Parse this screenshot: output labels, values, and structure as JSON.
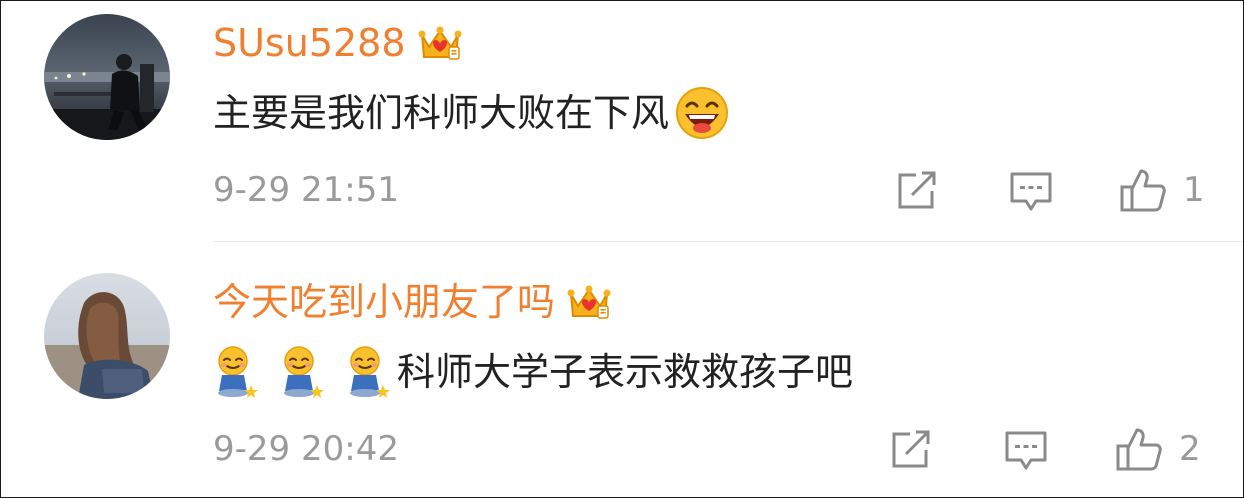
{
  "comments": [
    {
      "username": "SUsu5288",
      "badge_icon": "crown-badge-icon",
      "text": "主要是我们科师大败在下风",
      "emoji": "laughing-emoji-icon",
      "time": "9-29 21:51",
      "like_count": "1"
    },
    {
      "username": "今天吃到小朋友了吗",
      "badge_icon": "crown-badge-icon",
      "emojis": [
        "sitting-smile-emoji-icon",
        "sitting-smile-emoji-icon",
        "sitting-smile-emoji-icon"
      ],
      "text": "科师大学子表示救救孩子吧",
      "time": "9-29 20:42",
      "like_count": "2"
    }
  ],
  "colors": {
    "username": "#f0802f",
    "text": "#222222",
    "meta": "#9a9a9a",
    "divider": "#e6e6e6"
  }
}
